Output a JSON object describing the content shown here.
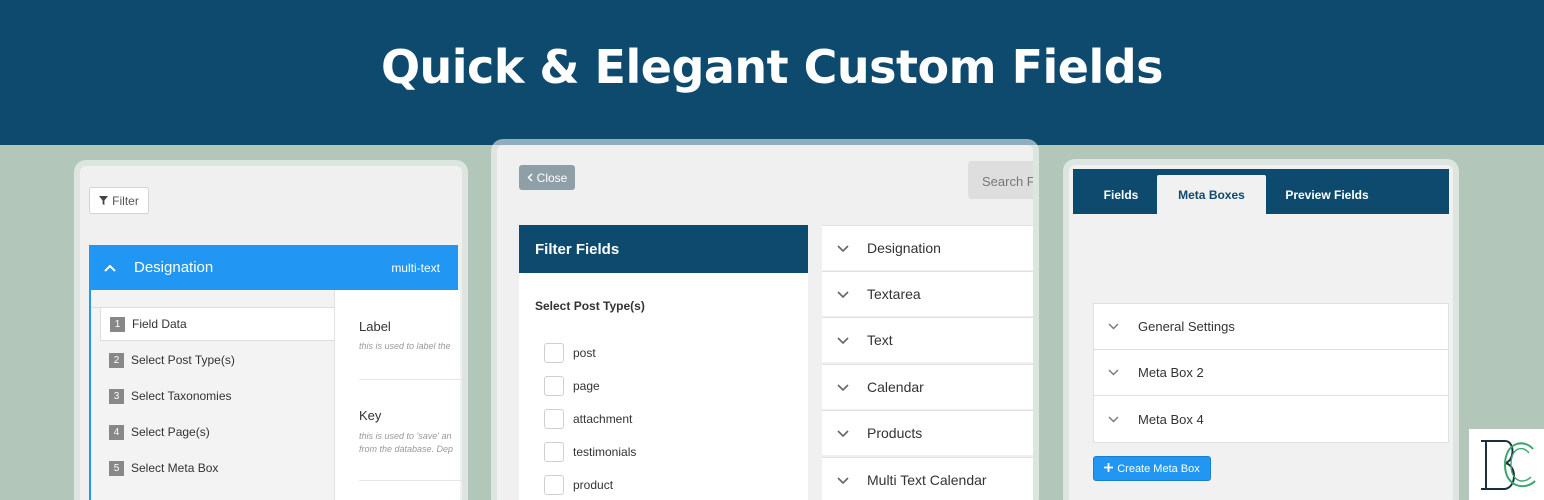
{
  "banner": {
    "title": "Quick & Elegant Custom Fields"
  },
  "colors": {
    "navy": "#0e4a6e",
    "blue": "#2196f3",
    "background": "#b2c6ba"
  },
  "left_panel": {
    "filter_label": "Filter",
    "field": {
      "name": "Designation",
      "type": "multi-text"
    },
    "steps": [
      {
        "num": "1",
        "label": "Field Data"
      },
      {
        "num": "2",
        "label": "Select Post Type(s)"
      },
      {
        "num": "3",
        "label": "Select Taxonomies"
      },
      {
        "num": "4",
        "label": "Select Page(s)"
      },
      {
        "num": "5",
        "label": "Select Meta Box"
      }
    ],
    "label_field": {
      "label": "Label",
      "hint": "this is used to label the"
    },
    "key_field": {
      "label": "Key",
      "hint": "this is used to 'save' an",
      "hint2": "from the database. Dep"
    }
  },
  "middle_panel": {
    "close_label": "Close",
    "search_placeholder": "Search F",
    "filter_title": "Filter Fields",
    "post_type_title": "Select Post Type(s)",
    "post_types": [
      "post",
      "page",
      "attachment",
      "testimonials",
      "product"
    ],
    "fields": [
      "Designation",
      "Textarea",
      "Text",
      "Calendar",
      "Products",
      "Multi Text Calendar"
    ]
  },
  "right_panel": {
    "tabs": [
      "Fields",
      "Meta Boxes",
      "Preview Fields"
    ],
    "active_tab": "Meta Boxes",
    "meta_boxes": [
      "General Settings",
      "Meta Box 2",
      "Meta Box 4"
    ],
    "create_label": "Create Meta Box"
  },
  "icons": {
    "filter": "funnel-icon",
    "collapse": "chevron-up-icon",
    "close": "chevron-left-icon",
    "expand": "chevron-down-icon",
    "add": "plus-icon",
    "brand": "logo-mark"
  }
}
